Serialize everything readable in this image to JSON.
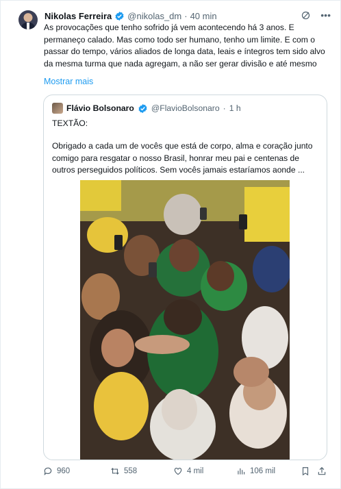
{
  "tweet": {
    "author_name": "Nikolas Ferreira",
    "handle": "@nikolas_dm",
    "separator": "·",
    "time": "40 min",
    "text": "As provocações que tenho sofrido já vem acontecendo há 3 anos. E permaneço calado. Mas como todo ser humano, tenho um limite. E com o passar do tempo, vários aliados de longa data, leais e íntegros tem sido alvo da mesma turma que nada agregam, a não ser gerar divisão e até mesmo",
    "show_more": "Mostrar mais"
  },
  "quoted": {
    "author_name": "Flávio Bolsonaro",
    "handle": "@FlavioBolsonaro",
    "separator": "·",
    "time": "1 h",
    "title": "TEXTÃO:",
    "text": "Obrigado a cada um de vocês que está de corpo, alma e coração junto comigo para resgatar o nosso Brasil, honrar meu pai e centenas de outros perseguidos políticos. Sem vocês jamais estaríamos aonde ..."
  },
  "actions": {
    "replies": "960",
    "retweets": "558",
    "likes": "4 mil",
    "views": "106 mil"
  },
  "colors": {
    "link": "#1d9bf0",
    "verified": "#1d9bf0",
    "muted": "#536471",
    "border": "#cfd9de"
  },
  "icons": [
    "grok-icon",
    "more-icon",
    "verified-icon",
    "reply-icon",
    "retweet-icon",
    "like-icon",
    "views-icon",
    "bookmark-icon",
    "share-icon"
  ]
}
